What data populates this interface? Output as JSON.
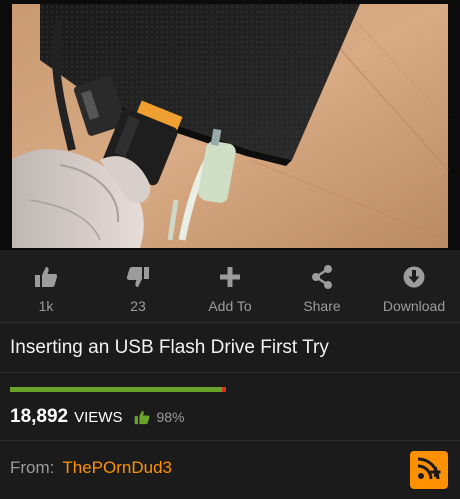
{
  "video": {
    "thumbnail_icon": "video-thumbnail"
  },
  "actions": [
    {
      "icon": "thumbs-up-icon",
      "label": "1k"
    },
    {
      "icon": "thumbs-down-icon",
      "label": "23"
    },
    {
      "icon": "plus-icon",
      "label": "Add To"
    },
    {
      "icon": "share-icon",
      "label": "Share"
    },
    {
      "icon": "download-icon",
      "label": "Download"
    }
  ],
  "title": "Inserting an USB Flash Drive First Try",
  "stats": {
    "rating_fraction": 0.98,
    "views": "18,892",
    "views_label": "VIEWS",
    "percent": "98%"
  },
  "from": {
    "label": "From:",
    "user": "ThePOrnDud3"
  },
  "colors": {
    "accent": "#ff9000",
    "positive": "#6aa32a",
    "negative": "#d6351c",
    "background": "#1b1b1b"
  },
  "subscribe_icon": "rss-plus-icon"
}
